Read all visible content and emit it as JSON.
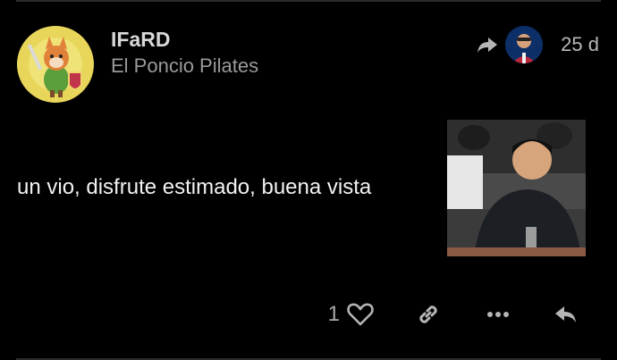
{
  "post": {
    "author": "IFaRD",
    "category": "El Poncio Pilates",
    "time_ago": "25 d",
    "body_text": "un vio, disfrute estimado, buena vista",
    "like_count": "1"
  },
  "icons": {
    "reply_indicator": "share-arrow-icon",
    "like": "heart-icon",
    "link": "link-icon",
    "more": "more-dots-icon",
    "reply": "reply-icon"
  },
  "colors": {
    "background": "#000000",
    "text_primary": "#f2f2f2",
    "text_muted": "#9a9a9a",
    "icon": "#b5b5b5"
  }
}
